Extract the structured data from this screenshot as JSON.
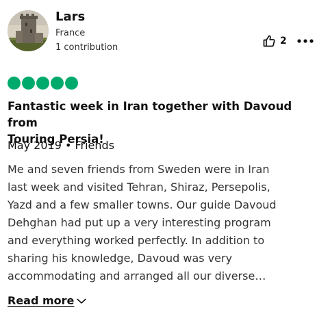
{
  "author": {
    "name": "Lars",
    "location": "France",
    "contributions": "1 contribution"
  },
  "helpful": {
    "icon": "thumbs-up-icon",
    "count": "2"
  },
  "more_menu": {
    "icon": "more-horizontal-icon"
  },
  "rating": {
    "value": 5,
    "max": 5,
    "color": "#00aa6c"
  },
  "review": {
    "title_lines": [
      "Fantastic week in Iran together with Davoud from",
      "Touring Persia!"
    ],
    "trip_info": "May 2019 • Friends",
    "body_lines": [
      "Me and seven friends from Sweden were in Iran",
      "last week and visited Tehran, Shiraz, Persepolis,",
      "Yazd and a few smaller towns. Our guide Davoud",
      "Dehghan had put up a very interesting program",
      "and everything worked perfectly. In addition to",
      "sharing his knowledge, Davoud was very",
      "accommodating and arranged all our diverse…"
    ],
    "read_more_label": "Read more",
    "read_more_icon": "chevron-down-icon"
  }
}
